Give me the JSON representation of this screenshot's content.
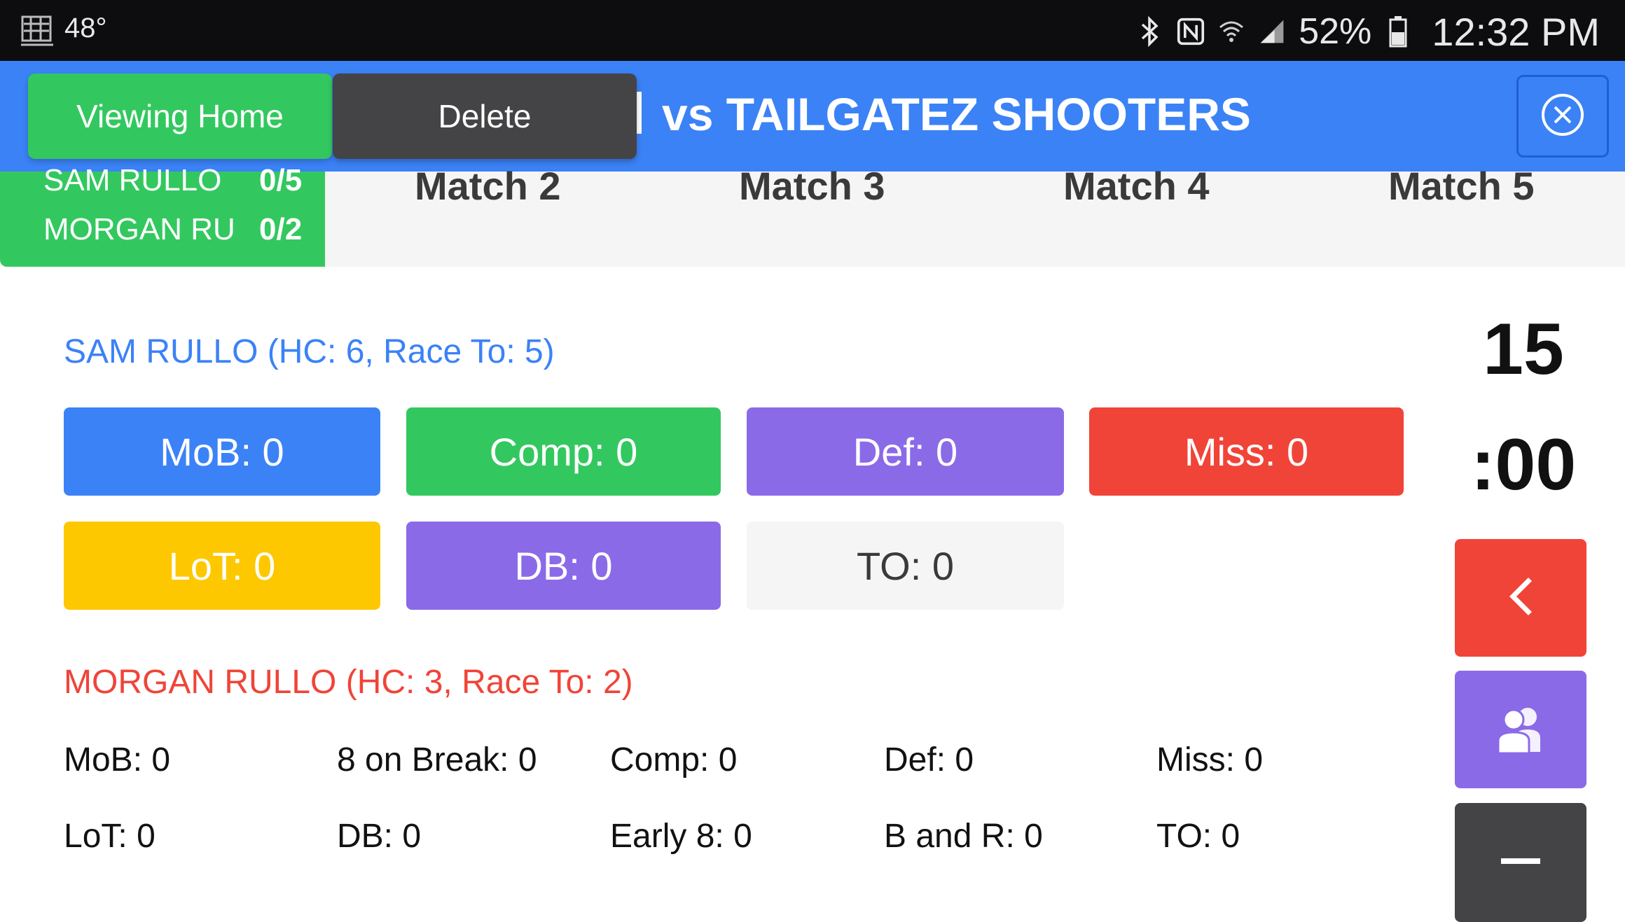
{
  "status_bar": {
    "temperature": "48°",
    "battery": "52%",
    "time": "12:32 PM",
    "icons": [
      "weather-icon",
      "bluetooth-icon",
      "nfc-icon",
      "wifi-icon",
      "signal-icon",
      "battery-icon"
    ]
  },
  "header": {
    "title": "vs TAILGATEZ SHOOTERS",
    "viewing_button": "Viewing Home",
    "delete_button": "Delete",
    "close_icon": "close-circle-icon",
    "color": "#3b82f6"
  },
  "match_tabs": {
    "active": {
      "player1": "SAM RULLO",
      "player1_score": "0/5",
      "player2": "MORGAN RU",
      "player2_score": "0/2"
    },
    "tabs": [
      "Match 2",
      "Match 3",
      "Match 4",
      "Match 5"
    ]
  },
  "player1": {
    "heading": "SAM RULLO (HC: 6, Race To: 5)",
    "buttons": [
      {
        "label": "MoB: 0",
        "color": "#3b82f6"
      },
      {
        "label": "Comp: 0",
        "color": "#33c85f"
      },
      {
        "label": "Def: 0",
        "color": "#8b6ae8"
      },
      {
        "label": "Miss: 0",
        "color": "#f04438"
      },
      {
        "label": "LoT: 0",
        "color": "#fdc800"
      },
      {
        "label": "DB: 0",
        "color": "#8b6ae8"
      },
      {
        "label": "TO: 0",
        "color": "#f5f5f5"
      }
    ]
  },
  "timer": {
    "minutes": "15",
    "seconds": ":00"
  },
  "side_controls": {
    "back_icon": "chevron-left-icon",
    "players_icon": "users-icon",
    "minus_icon": "minus-icon"
  },
  "player2": {
    "heading": "MORGAN RULLO (HC: 3, Race To: 2)",
    "stats_row1": [
      "MoB: 0",
      "8 on Break: 0",
      "Comp: 0",
      "Def: 0",
      "Miss: 0"
    ],
    "stats_row2": [
      "LoT: 0",
      "DB: 0",
      "Early 8: 0",
      "B and R: 0",
      "TO: 0"
    ]
  }
}
